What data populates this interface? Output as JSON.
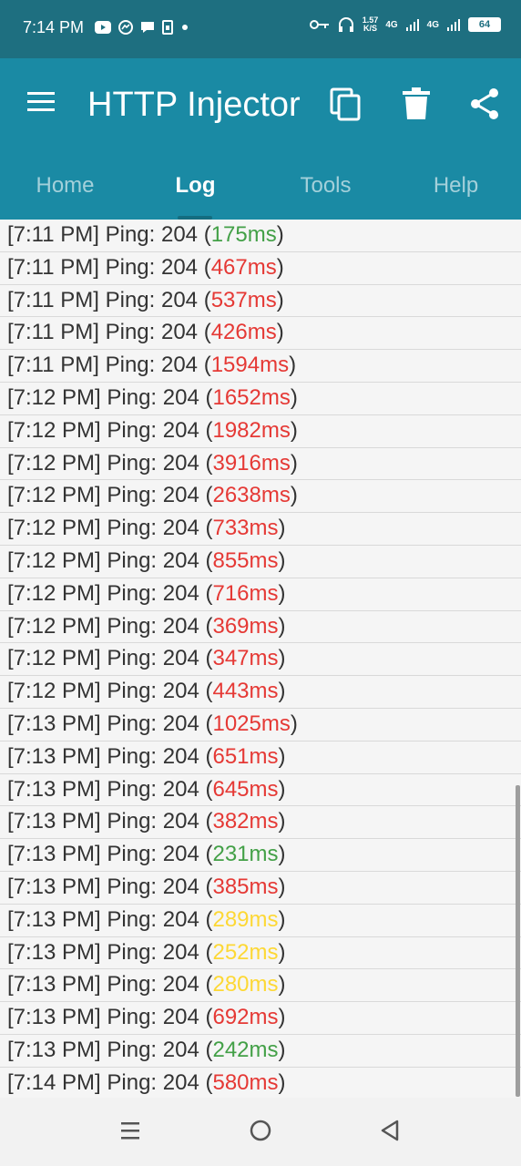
{
  "status_bar": {
    "time": "7:14 PM",
    "notification_icons": [
      "youtube-icon",
      "messenger-icon",
      "chat-icon",
      "sim-icon",
      "dot-icon"
    ],
    "speed_value": "1.57",
    "speed_unit": "K/S",
    "network_1": "4G",
    "network_2": "4G",
    "battery": "64"
  },
  "app_bar": {
    "title": "HTTP Injector"
  },
  "tabs": [
    {
      "label": "Home",
      "active": false
    },
    {
      "label": "Log",
      "active": true
    },
    {
      "label": "Tools",
      "active": false
    },
    {
      "label": "Help",
      "active": false
    }
  ],
  "colors": {
    "status_bar": "#1e6f80",
    "app_bar": "#1a8aa4",
    "red": "#e53935",
    "green": "#43a047",
    "yellow": "#fdd835"
  },
  "log": [
    {
      "time": "[7:11 PM]",
      "prefix": "Ping: 204 (",
      "ms": "175ms",
      "color": "green"
    },
    {
      "time": "[7:11 PM]",
      "prefix": "Ping: 204 (",
      "ms": "467ms",
      "color": "red"
    },
    {
      "time": "[7:11 PM]",
      "prefix": "Ping: 204 (",
      "ms": "537ms",
      "color": "red"
    },
    {
      "time": "[7:11 PM]",
      "prefix": "Ping: 204 (",
      "ms": "426ms",
      "color": "red"
    },
    {
      "time": "[7:11 PM]",
      "prefix": "Ping: 204 (",
      "ms": "1594ms",
      "color": "red"
    },
    {
      "time": "[7:12 PM]",
      "prefix": "Ping: 204 (",
      "ms": "1652ms",
      "color": "red"
    },
    {
      "time": "[7:12 PM]",
      "prefix": "Ping: 204 (",
      "ms": "1982ms",
      "color": "red"
    },
    {
      "time": "[7:12 PM]",
      "prefix": "Ping: 204 (",
      "ms": "3916ms",
      "color": "red"
    },
    {
      "time": "[7:12 PM]",
      "prefix": "Ping: 204 (",
      "ms": "2638ms",
      "color": "red"
    },
    {
      "time": "[7:12 PM]",
      "prefix": "Ping: 204 (",
      "ms": "733ms",
      "color": "red"
    },
    {
      "time": "[7:12 PM]",
      "prefix": "Ping: 204 (",
      "ms": "855ms",
      "color": "red"
    },
    {
      "time": "[7:12 PM]",
      "prefix": "Ping: 204 (",
      "ms": "716ms",
      "color": "red"
    },
    {
      "time": "[7:12 PM]",
      "prefix": "Ping: 204 (",
      "ms": "369ms",
      "color": "red"
    },
    {
      "time": "[7:12 PM]",
      "prefix": "Ping: 204 (",
      "ms": "347ms",
      "color": "red"
    },
    {
      "time": "[7:12 PM]",
      "prefix": "Ping: 204 (",
      "ms": "443ms",
      "color": "red"
    },
    {
      "time": "[7:13 PM]",
      "prefix": "Ping: 204 (",
      "ms": "1025ms",
      "color": "red"
    },
    {
      "time": "[7:13 PM]",
      "prefix": "Ping: 204 (",
      "ms": "651ms",
      "color": "red"
    },
    {
      "time": "[7:13 PM]",
      "prefix": "Ping: 204 (",
      "ms": "645ms",
      "color": "red"
    },
    {
      "time": "[7:13 PM]",
      "prefix": "Ping: 204 (",
      "ms": "382ms",
      "color": "red"
    },
    {
      "time": "[7:13 PM]",
      "prefix": "Ping: 204 (",
      "ms": "231ms",
      "color": "green"
    },
    {
      "time": "[7:13 PM]",
      "prefix": "Ping: 204 (",
      "ms": "385ms",
      "color": "red"
    },
    {
      "time": "[7:13 PM]",
      "prefix": "Ping: 204 (",
      "ms": "289ms",
      "color": "yellow"
    },
    {
      "time": "[7:13 PM]",
      "prefix": "Ping: 204 (",
      "ms": "252ms",
      "color": "yellow"
    },
    {
      "time": "[7:13 PM]",
      "prefix": "Ping: 204 (",
      "ms": "280ms",
      "color": "yellow"
    },
    {
      "time": "[7:13 PM]",
      "prefix": "Ping: 204 (",
      "ms": "692ms",
      "color": "red"
    },
    {
      "time": "[7:13 PM]",
      "prefix": "Ping: 204 (",
      "ms": "242ms",
      "color": "green"
    },
    {
      "time": "[7:14 PM]",
      "prefix": "Ping: 204 (",
      "ms": "580ms",
      "color": "red"
    }
  ],
  "log_suffix": ")",
  "nav_bar": {
    "buttons": [
      "recents-icon",
      "home-circle-icon",
      "back-triangle-icon"
    ]
  }
}
